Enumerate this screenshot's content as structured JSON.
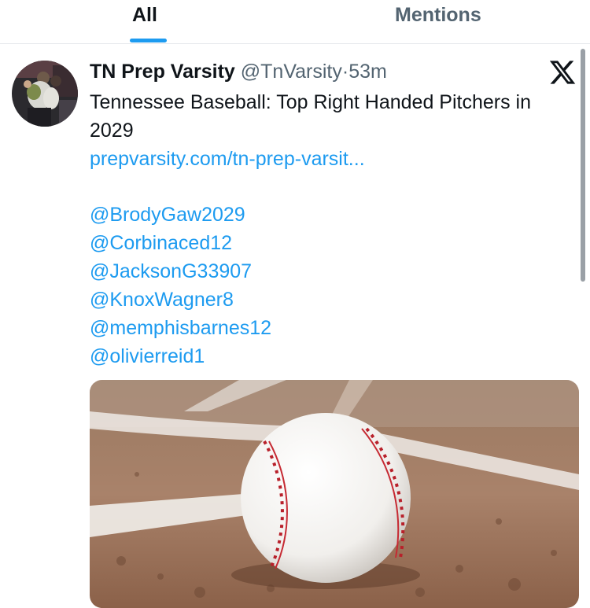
{
  "tabs": {
    "all_label": "All",
    "mentions_label": "Mentions"
  },
  "tweet": {
    "display_name": "TN Prep Varsity",
    "handle": "@TnVarsity",
    "separator": "·",
    "time": "53m",
    "text": "Tennessee Baseball: Top Right Handed Pitchers in 2029",
    "link": "prepvarsity.com/tn-prep-varsit...",
    "mentions": [
      "@BrodyGaw2029",
      "@Corbinaced12",
      "@JacksonG33907",
      "@KnoxWagner8",
      "@memphisbarnes12",
      "@olivierreid1"
    ]
  },
  "icons": {
    "platform_logo": "x-logo-icon",
    "avatar": "avatar"
  },
  "colors": {
    "accent": "#1d9bf0",
    "text": "#0f1419",
    "secondary_text": "#536471"
  }
}
